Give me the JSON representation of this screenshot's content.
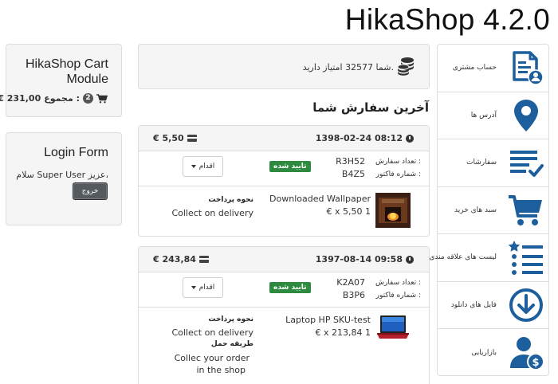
{
  "site_title": "HikaShop 4.2.0",
  "cart_module": {
    "title_line1": "HikaShop Cart",
    "title_line2": "Module",
    "count": "2",
    "total_label": "مجموع :",
    "total": "€ 231,00",
    "icon": "cart-icon"
  },
  "login_module": {
    "title": "Login Form",
    "greeting": "سلام Super User عزیز،",
    "logout_label": "خروج"
  },
  "points": {
    "text": "شما 32577 امتیاز دارید.",
    "icon": "coins-icon"
  },
  "orders_section_title": "آخرین سفارش شما",
  "orders": [
    {
      "date": "1398-02-24 08:12",
      "amount": "€ 5,50",
      "count_label": "تعداد سفارش :",
      "count_value": "R3H52",
      "invoice_label": "شماره فاکتور :",
      "invoice_value": "B4Z5",
      "status": "تایید شده",
      "action_label": "اقدام",
      "product_name": "Downloaded Wallpaper",
      "product_price": "1 x 5,50 €",
      "payment_label": "نحوه پرداخت",
      "payment_value": "Collect on delivery"
    },
    {
      "date": "1397-08-14 09:58",
      "amount": "€ 243,84",
      "count_label": "تعداد سفارش :",
      "count_value": "K2A07",
      "invoice_label": "شماره فاکتور :",
      "invoice_value": "B3P6",
      "status": "تایید شده",
      "action_label": "اقدام",
      "product_name": "Laptop HP SKU-test",
      "product_price": "1 x 213,84 €",
      "payment_label": "نحوه پرداخت",
      "payment_value": "Collect on delivery",
      "shipping_label": "طریقه حمل",
      "shipping_value_line1": "Collec your order",
      "shipping_value_line2": "in the shop"
    }
  ],
  "menu": [
    {
      "label": "حساب مشتری",
      "icon": "account-icon"
    },
    {
      "label": "آدرس ها",
      "icon": "location-pin-icon"
    },
    {
      "label": "سفارشات",
      "icon": "orders-list-icon"
    },
    {
      "label": "سبد های خرید",
      "icon": "cart-icon"
    },
    {
      "label": "لیست های علاقه مندی",
      "icon": "wishlist-icon"
    },
    {
      "label": "فایل های دانلود",
      "icon": "download-icon"
    },
    {
      "label": "بازاریابی",
      "icon": "affiliate-icon"
    }
  ],
  "colors": {
    "accent": "#1d5f9c",
    "status_green": "#2d8a3e"
  }
}
